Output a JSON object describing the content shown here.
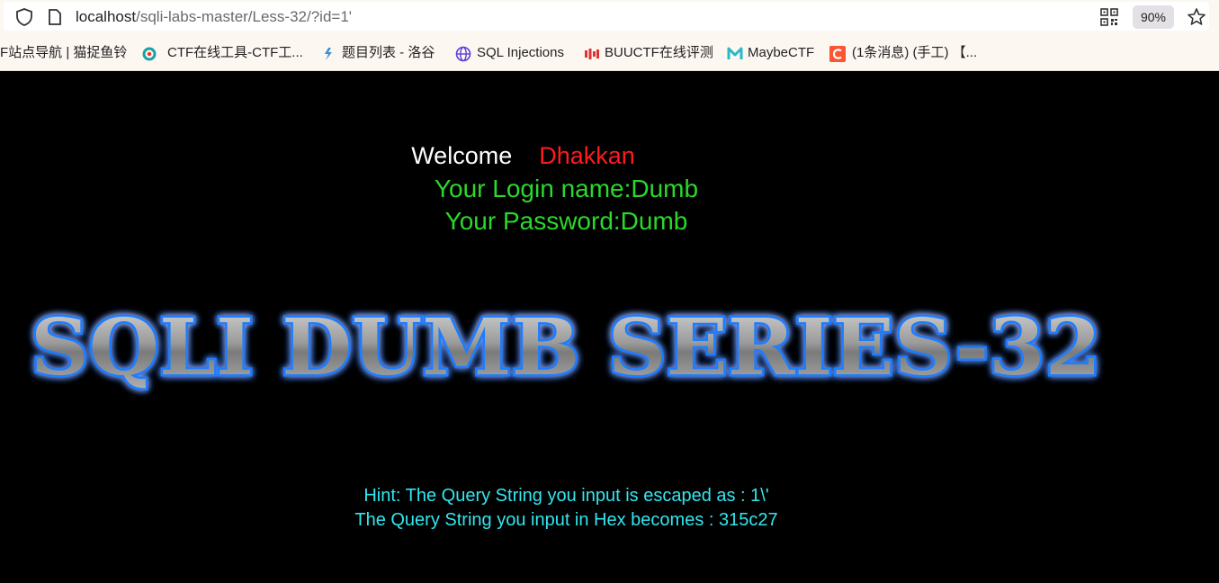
{
  "browser": {
    "url_host": "localhost",
    "url_path": "/sqli-labs-master/Less-32/?id=1'",
    "zoom": "90%"
  },
  "bookmarks": [
    {
      "label": "F站点导航 | 猫捉鱼铃",
      "icon": "none"
    },
    {
      "label": "CTF在线工具-CTF工...",
      "icon": "ctf-tools-icon"
    },
    {
      "label": "题目列表 - 洛谷",
      "icon": "luogu-icon"
    },
    {
      "label": "SQL Injections",
      "icon": "globe-icon"
    },
    {
      "label": "BUUCTF在线评测",
      "icon": "buuctf-icon"
    },
    {
      "label": "MaybeCTF",
      "icon": "maybectf-icon"
    },
    {
      "label": "(1条消息) (手工) 【...",
      "icon": "csdn-icon"
    }
  ],
  "page": {
    "welcome_label": "Welcome",
    "welcome_name": "Dhakkan",
    "login_line": "Your Login name:Dumb",
    "password_line": "Your Password:Dumb",
    "banner_text": "SQLI DUMB SERIES-32",
    "hint_line": "Hint: The Query String you input is escaped as : 1\\'",
    "hex_line": "The Query String you input in Hex becomes : 315c27"
  },
  "colors": {
    "background": "#000000",
    "welcome": "#ffffff",
    "name": "#ff1b1b",
    "credentials": "#2bd82b",
    "hint": "#33e6f0",
    "banner_glow": "#1a7dff"
  }
}
